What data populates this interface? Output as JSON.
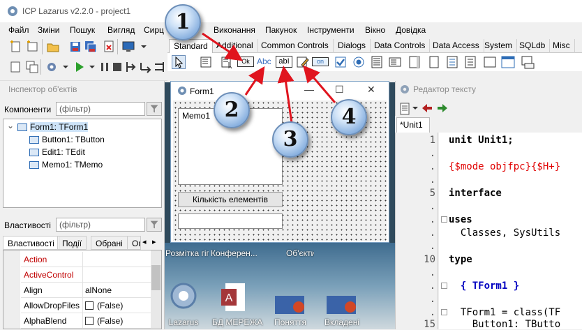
{
  "window": {
    "title": "ICP Lazarus v2.2.0 - project1"
  },
  "menu": {
    "items": [
      "Файл",
      "Зміни",
      "Пошук",
      "Вигляд",
      "Сирц",
      "Виконання",
      "Пакунок",
      "Інструменти",
      "Вікно",
      "Довідка"
    ]
  },
  "palette": {
    "tabs": [
      "Standard",
      "Additional",
      "Common Controls",
      "Dialogs",
      "Data Controls",
      "Data Access",
      "System",
      "SQLdb",
      "Misc"
    ],
    "active_tab": "Standard",
    "button_icon_text": "Ok",
    "label_icon_text": "Abc",
    "edit_icon_text": "abI",
    "toggle_icon_text": "on"
  },
  "inspector": {
    "title": "Інспектор об'єктів",
    "components_label": "Компоненти",
    "filter_placeholder": "(фільтр)",
    "tree": [
      "Form1: TForm1",
      "Button1: TButton",
      "Edit1: TEdit",
      "Memo1: TMemo"
    ],
    "properties_label": "Властивості",
    "tabs": [
      "Властивості",
      "Події",
      "Обрані",
      "Ог"
    ],
    "properties": [
      {
        "name": "Action",
        "value": "",
        "red": true,
        "checkbox": false
      },
      {
        "name": "ActiveControl",
        "value": "",
        "red": true,
        "checkbox": false
      },
      {
        "name": "Align",
        "value": "alNone",
        "red": false,
        "checkbox": false
      },
      {
        "name": "AllowDropFiles",
        "value": "(False)",
        "red": false,
        "checkbox": true
      },
      {
        "name": "AlphaBlend",
        "value": "(False)",
        "red": false,
        "checkbox": true
      }
    ]
  },
  "form": {
    "title": "Form1",
    "memo_text": "Memo1",
    "button_caption": "Кількість елементів",
    "edit_text": ""
  },
  "desktop": {
    "top_labels": [
      "Розмітка гіпертекс...",
      "Конферен... Zoom.pdf",
      "Об'єкти та події. Вк..."
    ],
    "icons": [
      "Lazarus",
      "БД МЕРЕЖА",
      "Поняття",
      "Вкладені"
    ]
  },
  "editor": {
    "title": "Редактор тексту",
    "tab": "*Unit1",
    "lines": [
      {
        "num": "1",
        "text": "unit Unit1;",
        "style": "normal"
      },
      {
        "num": ".",
        "text": "",
        "style": "normal"
      },
      {
        "num": ".",
        "text": "{$mode objfpc}{$H+}",
        "style": "directive"
      },
      {
        "num": ".",
        "text": "",
        "style": "normal"
      },
      {
        "num": "5",
        "text": "interface",
        "style": "keyword"
      },
      {
        "num": ".",
        "text": "",
        "style": "normal"
      },
      {
        "num": ".",
        "text": "uses",
        "style": "keyword"
      },
      {
        "num": ".",
        "text": "  Classes, SysUtils",
        "style": "normal"
      },
      {
        "num": ".",
        "text": "",
        "style": "normal"
      },
      {
        "num": "10",
        "text": "type",
        "style": "keyword"
      },
      {
        "num": ".",
        "text": "",
        "style": "normal"
      },
      {
        "num": ".",
        "text": "  { TForm1 }",
        "style": "comment"
      },
      {
        "num": ".",
        "text": "",
        "style": "normal"
      },
      {
        "num": ".",
        "text": "  TForm1 = class(TF",
        "style": "normal"
      },
      {
        "num": "15",
        "text": "    Button1: TButto",
        "style": "normal"
      }
    ]
  },
  "callouts": [
    "1",
    "2",
    "3",
    "4"
  ],
  "colors": {
    "accent": "#2d6cb5",
    "arrow": "#e0141e",
    "property_red": "#c00000",
    "directive": "#e00000",
    "comment_blue": "#0000c0"
  }
}
